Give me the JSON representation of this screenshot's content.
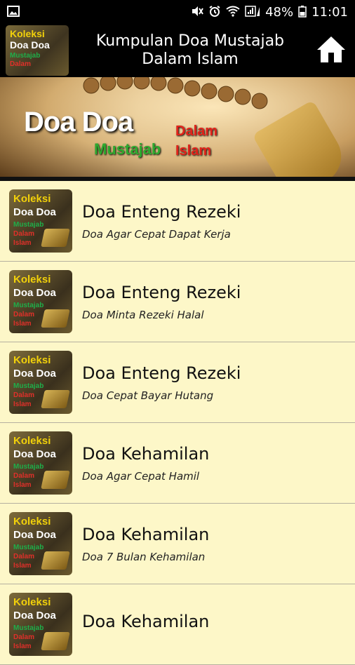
{
  "status_bar": {
    "battery_percent": "48%",
    "time": "11:01",
    "left_icon": "image-icon",
    "right_icons": [
      "mute-icon",
      "alarm-icon",
      "wifi-icon",
      "signal-icon",
      "battery-icon"
    ]
  },
  "app_bar": {
    "logo_text": [
      "Koleksi",
      "Doa Doa",
      "Mustajab",
      "Dalam",
      "Islam"
    ],
    "title": "Kumpulan Doa Mustajab Dalam Islam",
    "home_icon": "home-icon"
  },
  "banner": {
    "line1": "Doa Doa",
    "line2": "Mustajab",
    "line3": "Dalam",
    "line4": "Islam"
  },
  "thumb_text": [
    "Koleksi",
    "Doa Doa",
    "Mustajab",
    "Dalam",
    "Islam"
  ],
  "list": [
    {
      "title": "Doa Enteng Rezeki",
      "subtitle": "Doa Agar Cepat Dapat Kerja"
    },
    {
      "title": "Doa Enteng Rezeki",
      "subtitle": "Doa Minta Rezeki Halal"
    },
    {
      "title": "Doa Enteng Rezeki",
      "subtitle": "Doa Cepat Bayar Hutang"
    },
    {
      "title": "Doa Kehamilan",
      "subtitle": "Doa Agar Cepat Hamil"
    },
    {
      "title": "Doa Kehamilan",
      "subtitle": "Doa 7 Bulan Kehamilan"
    },
    {
      "title": "Doa Kehamilan",
      "subtitle": ""
    }
  ]
}
